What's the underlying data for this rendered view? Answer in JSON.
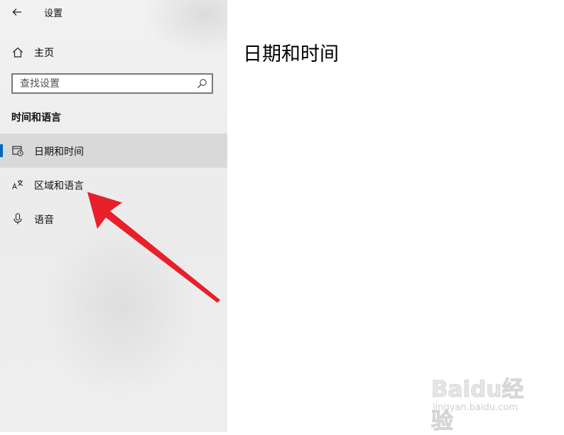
{
  "window": {
    "title": "设置"
  },
  "nav": {
    "home_label": "主页"
  },
  "search": {
    "placeholder": "查找设置"
  },
  "section": {
    "heading": "时间和语言"
  },
  "nav_items": [
    {
      "label": "日期和时间",
      "icon": "calendar-clock-icon",
      "selected": true
    },
    {
      "label": "区域和语言",
      "icon": "language-icon",
      "selected": false
    },
    {
      "label": "语音",
      "icon": "microphone-icon",
      "selected": false
    }
  ],
  "main": {
    "title": "日期和时间"
  },
  "annotation": {
    "type": "red-arrow",
    "color": "#e8202a",
    "points_to": "区域和语言"
  },
  "watermark": {
    "brand": "Baidu经验",
    "url": "jingyan.baidu.com"
  },
  "colors": {
    "accent": "#0067c0",
    "selected_bg": "#d9d9d9",
    "sidebar_bg": "#eeeeee"
  }
}
